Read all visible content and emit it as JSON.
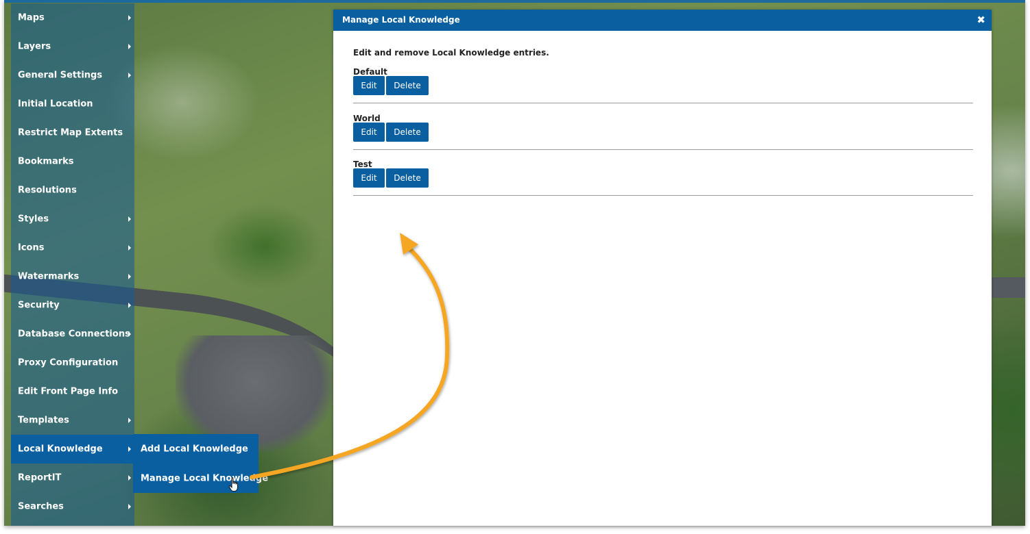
{
  "menu": {
    "items": [
      {
        "label": "Maps",
        "has_submenu": true
      },
      {
        "label": "Layers",
        "has_submenu": true
      },
      {
        "label": "General Settings",
        "has_submenu": true
      },
      {
        "label": "Initial Location",
        "has_submenu": false
      },
      {
        "label": "Restrict Map Extents",
        "has_submenu": false
      },
      {
        "label": "Bookmarks",
        "has_submenu": false
      },
      {
        "label": "Resolutions",
        "has_submenu": false
      },
      {
        "label": "Styles",
        "has_submenu": true
      },
      {
        "label": "Icons",
        "has_submenu": true
      },
      {
        "label": "Watermarks",
        "has_submenu": true
      },
      {
        "label": "Security",
        "has_submenu": true
      },
      {
        "label": "Database Connections",
        "has_submenu": true
      },
      {
        "label": "Proxy Configuration",
        "has_submenu": false
      },
      {
        "label": "Edit Front Page Info",
        "has_submenu": false
      },
      {
        "label": "Templates",
        "has_submenu": true
      },
      {
        "label": "Local Knowledge",
        "has_submenu": true,
        "active": true
      },
      {
        "label": "ReportIT",
        "has_submenu": true
      },
      {
        "label": "Searches",
        "has_submenu": true
      }
    ]
  },
  "submenu": {
    "items": [
      {
        "label": "Add Local Knowledge"
      },
      {
        "label": "Manage Local Knowledge"
      }
    ]
  },
  "dialog": {
    "title": "Manage Local Knowledge",
    "close_icon": "✖",
    "intro": "Edit and remove Local Knowledge entries.",
    "entries": [
      {
        "name": "Default",
        "edit_label": "Edit",
        "delete_label": "Delete"
      },
      {
        "name": "World",
        "edit_label": "Edit",
        "delete_label": "Delete"
      },
      {
        "name": "Test",
        "edit_label": "Edit",
        "delete_label": "Delete"
      }
    ]
  },
  "colors": {
    "primary": "#0a5fa0",
    "annotation_arrow": "#f5a623"
  },
  "icons": {
    "submenu_arrow": "chevron-right-icon",
    "cursor": "hand-pointer-icon",
    "close": "close-icon"
  }
}
